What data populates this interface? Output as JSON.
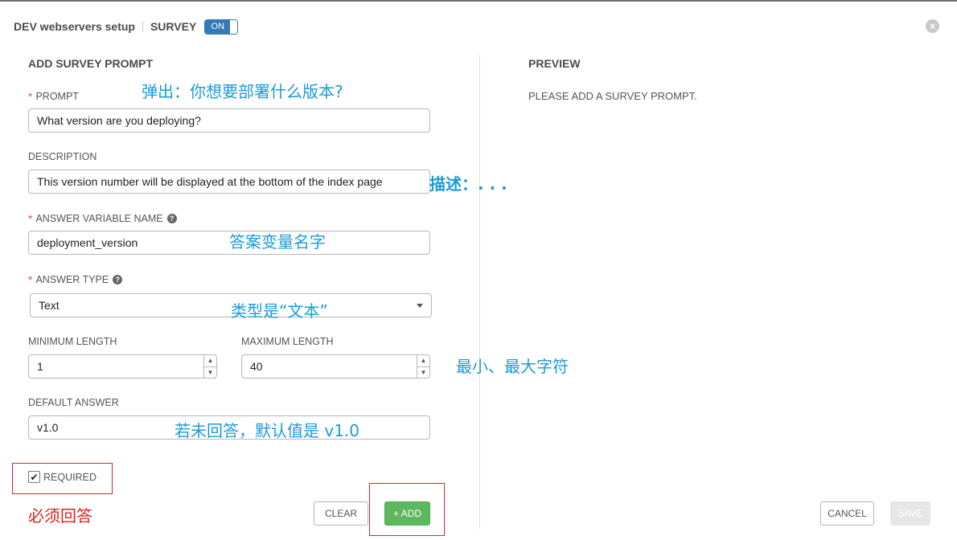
{
  "header": {
    "title": "DEV webservers setup",
    "survey_label": "SURVEY",
    "toggle_state": "ON"
  },
  "form": {
    "section_title": "ADD SURVEY PROMPT",
    "prompt": {
      "label": "PROMPT",
      "value": "What version are you deploying?"
    },
    "description": {
      "label": "DESCRIPTION",
      "value": "This version number will be displayed at the bottom of the index page"
    },
    "variable_name": {
      "label": "ANSWER VARIABLE NAME",
      "value": "deployment_version"
    },
    "answer_type": {
      "label": "ANSWER TYPE",
      "value": "Text"
    },
    "min_length": {
      "label": "MINIMUM LENGTH",
      "value": "1"
    },
    "max_length": {
      "label": "MAXIMUM LENGTH",
      "value": "40"
    },
    "default_answer": {
      "label": "DEFAULT ANSWER",
      "value": "v1.0"
    },
    "required": {
      "label": "REQUIRED",
      "checked": true
    },
    "clear_label": "CLEAR",
    "add_label": "+ ADD"
  },
  "preview": {
    "title": "PREVIEW",
    "empty_text": "PLEASE ADD A SURVEY PROMPT."
  },
  "footer": {
    "cancel_label": "CANCEL",
    "save_label": "SAVE"
  },
  "annotations": {
    "prompt": "弹出：你想要部署什么版本?",
    "description": "描述：. . .",
    "variable": "答案变量名字",
    "type": "类型是“文本”",
    "length": "最小、最大字符",
    "default": "若未回答，默认值是 v1.0",
    "required": "必须回答"
  },
  "colors": {
    "annotation_blue": "#1b9bd8",
    "annotation_red": "#e02020",
    "toggle_blue": "#337ab7",
    "add_green": "#5cb85c",
    "required_red": "#d9534f"
  }
}
